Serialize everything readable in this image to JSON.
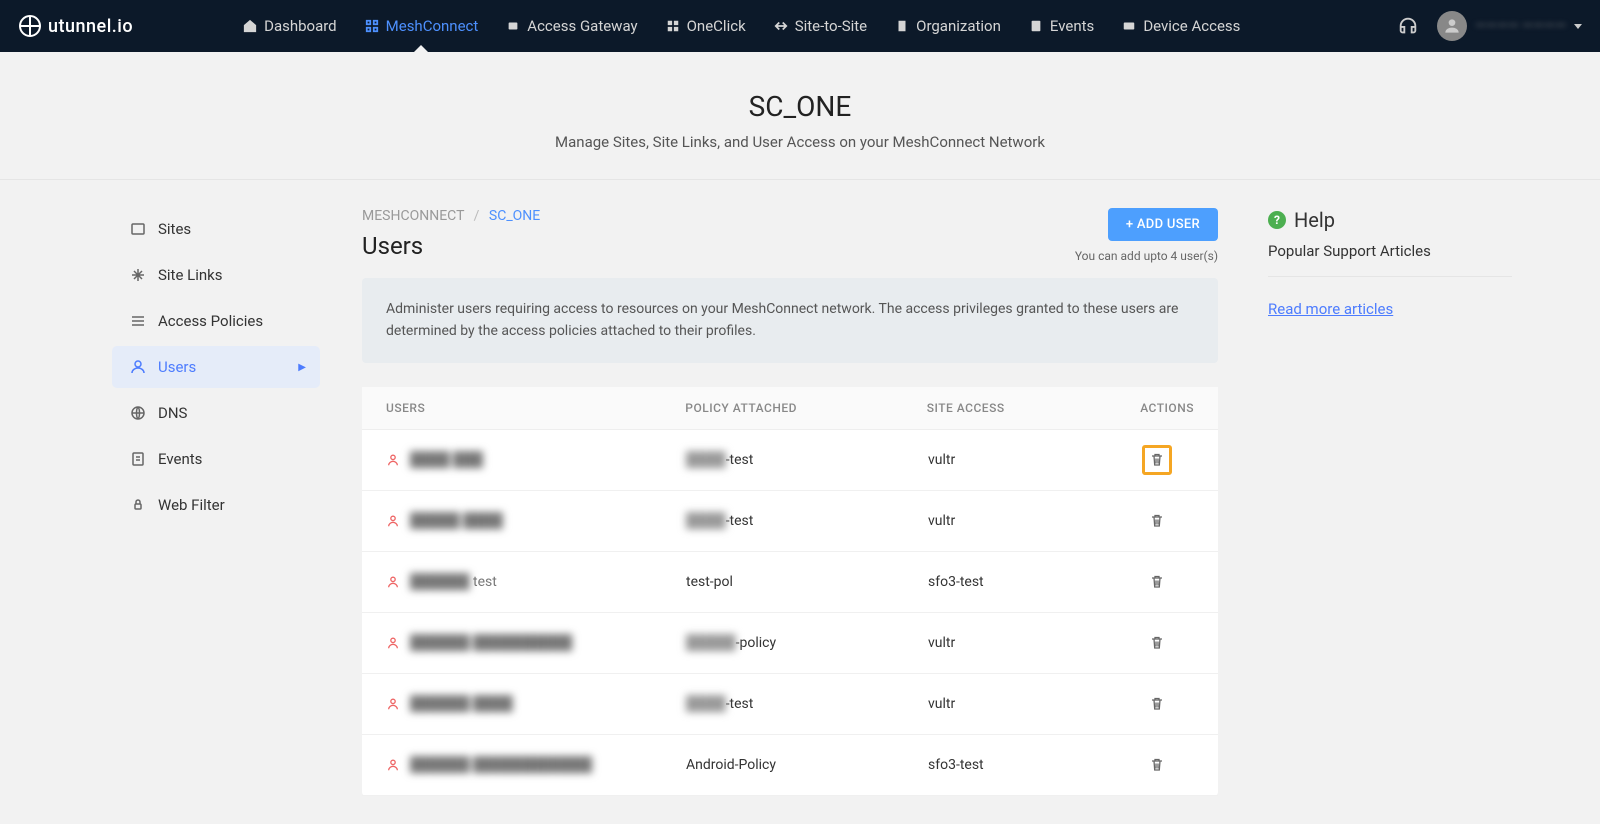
{
  "brand": "utunnel.io",
  "nav": {
    "dashboard": "Dashboard",
    "meshconnect": "MeshConnect",
    "access_gateway": "Access Gateway",
    "oneclick": "OneClick",
    "site_to_site": "Site-to-Site",
    "organization": "Organization",
    "events": "Events",
    "device_access": "Device Access"
  },
  "user_display": "———— ————",
  "header": {
    "title": "SC_ONE",
    "subtitle": "Manage Sites, Site Links, and User Access on your MeshConnect Network"
  },
  "sidebar": {
    "sites": "Sites",
    "site_links": "Site Links",
    "access_policies": "Access Policies",
    "users": "Users",
    "dns": "DNS",
    "events": "Events",
    "web_filter": "Web Filter"
  },
  "breadcrumb": {
    "root": "MESHCONNECT",
    "current": "SC_ONE"
  },
  "section": {
    "title": "Users",
    "add_btn": "+ ADD USER",
    "quota": "You can add upto 4 user(s)",
    "banner": "Administer users requiring access to resources on your MeshConnect network. The access privileges granted to these users are determined by the access policies attached to their profiles."
  },
  "columns": {
    "users": "USERS",
    "policy": "POLICY ATTACHED",
    "site": "SITE ACCESS",
    "actions": "ACTIONS"
  },
  "rows": [
    {
      "user_blur": "████ ███",
      "user_clear": "",
      "policy_blur": "████",
      "policy_suffix": "-test",
      "site": "vultr",
      "hl": true
    },
    {
      "user_blur": "█████ ████",
      "user_clear": "",
      "policy_blur": "████",
      "policy_suffix": "-test",
      "site": "vultr",
      "hl": false
    },
    {
      "user_blur": "██████",
      "user_clear": " test",
      "policy_blur": "",
      "policy_suffix": "test-pol",
      "site": "sfo3-test",
      "hl": false
    },
    {
      "user_blur": "██████ ██████████",
      "user_clear": "",
      "policy_blur": "█████",
      "policy_suffix": "-policy",
      "site": "vultr",
      "hl": false
    },
    {
      "user_blur": "██████ ████",
      "user_clear": "",
      "policy_blur": "████",
      "policy_suffix": "-test",
      "site": "vultr",
      "hl": false
    },
    {
      "user_blur": "██████ ████████████",
      "user_clear": "",
      "policy_blur": "",
      "policy_suffix": "Android-Policy",
      "site": "sfo3-test",
      "hl": false
    }
  ],
  "help": {
    "title": "Help",
    "subtitle": "Popular Support Articles",
    "link": "Read more articles"
  }
}
